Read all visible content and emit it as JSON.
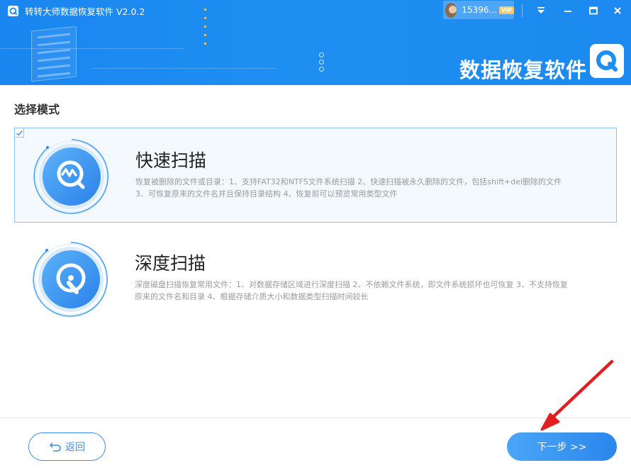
{
  "window": {
    "title": "转转大师数据恢复软件 V2.0.2",
    "user": {
      "name": "15396...",
      "badge": "VIP"
    },
    "brand_text": "数据恢复软件"
  },
  "section_title": "选择模式",
  "modes": [
    {
      "name": "快速扫描",
      "selected": true,
      "icon": "quick-scan-icon",
      "description": "恢复被删除的文件或目录：1、支持FAT32和NTFS文件系统扫描 2、快速扫描被永久删除的文件，包括shift+del删除的文件 3、可恢复原来的文件名并且保持目录结构 4、恢复前可以预览常用类型文件"
    },
    {
      "name": "深度扫描",
      "selected": false,
      "icon": "deep-scan-icon",
      "description": "深度磁盘扫描恢复常用文件：1、对数据存储区域进行深度扫描 2、不依赖文件系统，即文件系统损坏也可恢复 3、不支持恢复原来的文件名和目录 4、根据存储介质大小和数据类型扫描时间较长"
    }
  ],
  "footer": {
    "back_label": "返回",
    "next_label": "下一步 >>"
  },
  "colors": {
    "accent": "#1e8ff2",
    "selected_border": "#8cc3f5",
    "annotation": "#e02020"
  }
}
